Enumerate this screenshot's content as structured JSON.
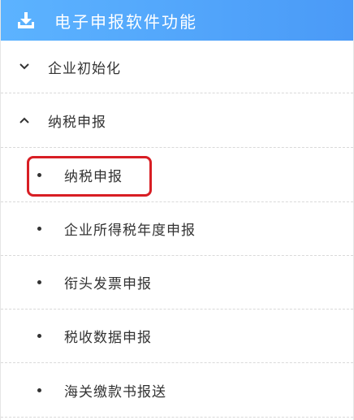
{
  "header": {
    "icon": "download-icon",
    "title": "电子申报软件功能"
  },
  "menu": {
    "groups": [
      {
        "label": "企业初始化",
        "state": "collapsed",
        "chevron_icon": "chevron-down-icon"
      },
      {
        "label": "纳税申报",
        "state": "expanded",
        "chevron_icon": "chevron-up-icon"
      }
    ],
    "sub_items": [
      {
        "label": "纳税申报",
        "highlighted": true
      },
      {
        "label": "企业所得税年度申报"
      },
      {
        "label": "衔头发票申报"
      },
      {
        "label": "税收数据申报"
      },
      {
        "label": "海关缴款书报送"
      }
    ]
  },
  "colors": {
    "header_start": "#5cb3ff",
    "header_end": "#4a9af7",
    "highlight_border": "#d81e24",
    "text": "#333333"
  }
}
